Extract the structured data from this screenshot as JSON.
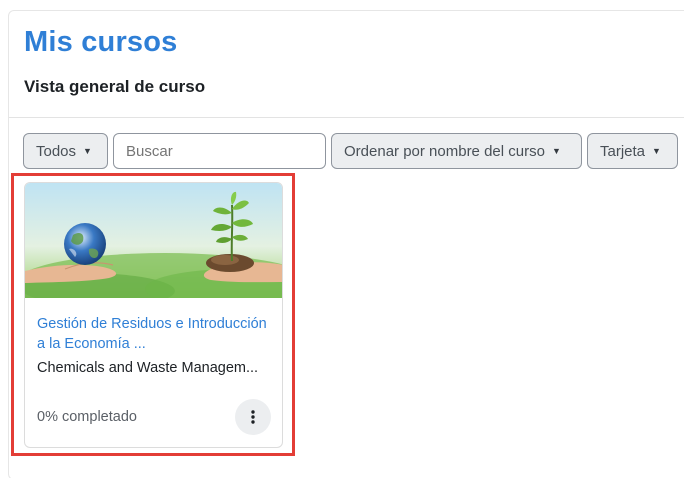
{
  "header": {
    "title": "Mis cursos",
    "subtitle": "Vista general de curso"
  },
  "filters": {
    "grouping_label": "Todos",
    "search_placeholder": "Buscar",
    "sort_label": "Ordenar por nombre del curso",
    "view_label": "Tarjeta"
  },
  "course_card": {
    "title": "Gestión de Residuos e Introducción a la Economía ...",
    "category": "Chemicals and Waste Managem...",
    "progress_text": "0% completado",
    "progress_percent": 0,
    "menu_icon": "kebab-vertical-icon"
  },
  "colors": {
    "accent": "#2f7fd6",
    "highlight": "#e33d36"
  }
}
